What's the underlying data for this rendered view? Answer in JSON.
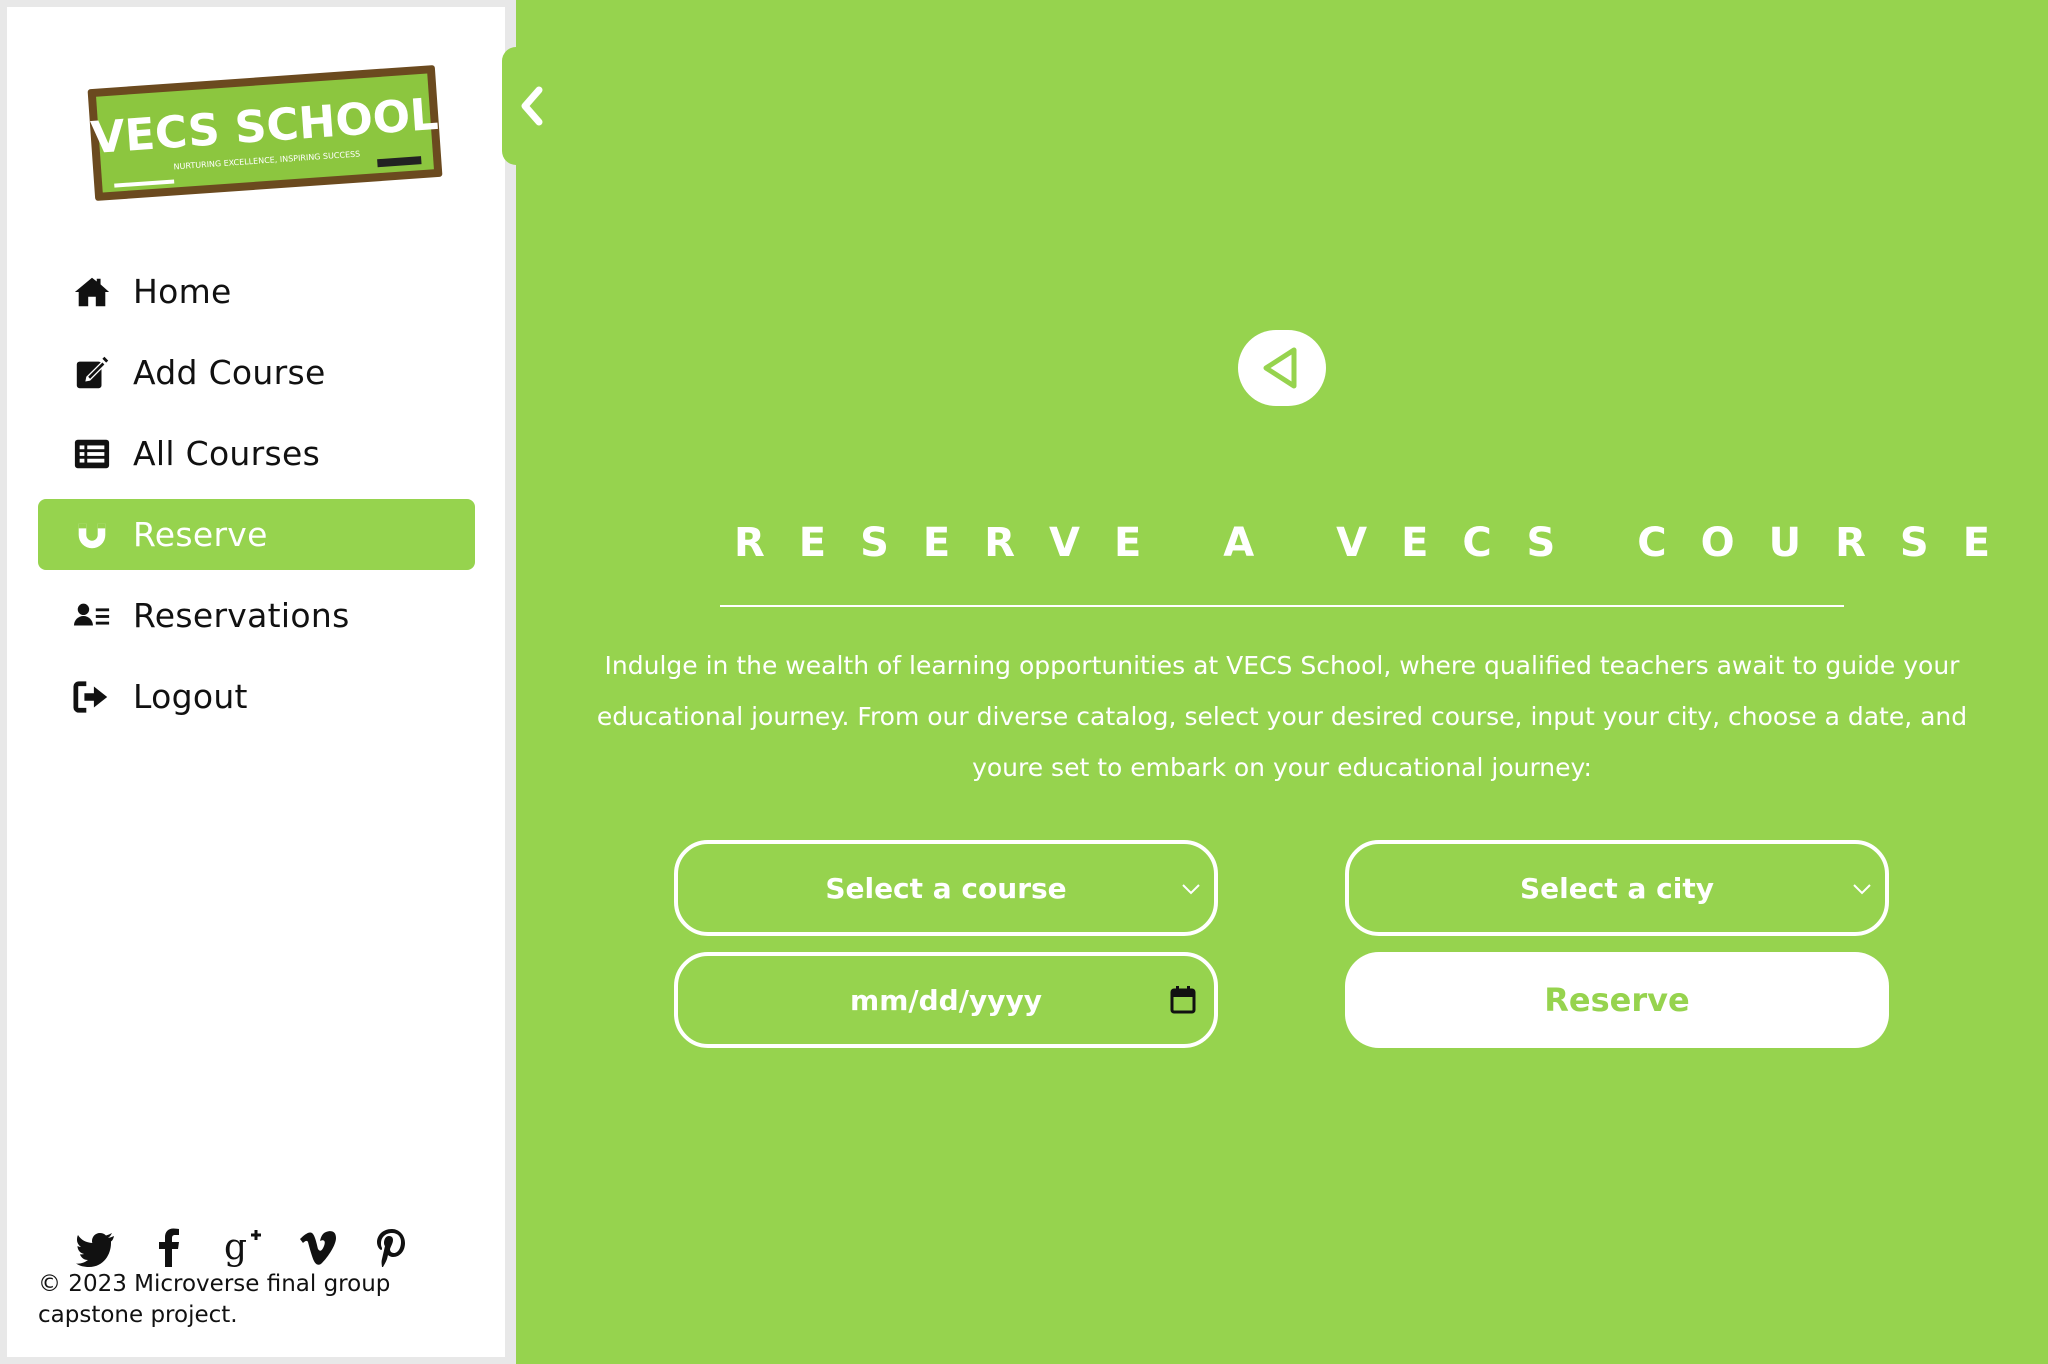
{
  "colors": {
    "accent": "#96d34e",
    "sidebar_bg": "#ffffff",
    "text": "#111111"
  },
  "logo": {
    "title": "VECS SCHOOL",
    "tagline": "NURTURING EXCELLENCE, INSPIRING SUCCESS"
  },
  "sidebar": {
    "items": [
      {
        "label": "Home",
        "icon": "home-icon",
        "active": false
      },
      {
        "label": "Add Course",
        "icon": "edit-icon",
        "active": false
      },
      {
        "label": "All Courses",
        "icon": "list-icon",
        "active": false
      },
      {
        "label": "Reserve",
        "icon": "magnet-icon",
        "active": true
      },
      {
        "label": "Reservations",
        "icon": "user-list-icon",
        "active": false
      },
      {
        "label": "Logout",
        "icon": "logout-icon",
        "active": false
      }
    ],
    "socials": [
      "twitter-icon",
      "facebook-icon",
      "google-plus-icon",
      "vimeo-icon",
      "pinterest-icon"
    ],
    "footer": "© 2023 Microverse final group capstone project."
  },
  "main": {
    "title": "RESERVE A VECS COURSE",
    "description": "Indulge in the wealth of learning opportunities at VECS School, where qualified teachers await to guide your educational journey. From our diverse catalog, select your desired course, input your city, choose a date, and youre set to embark on your educational journey:",
    "form": {
      "course_placeholder": "Select a course",
      "city_placeholder": "Select a city",
      "date_placeholder": "mm/dd/yyyy",
      "submit_label": "Reserve"
    }
  }
}
